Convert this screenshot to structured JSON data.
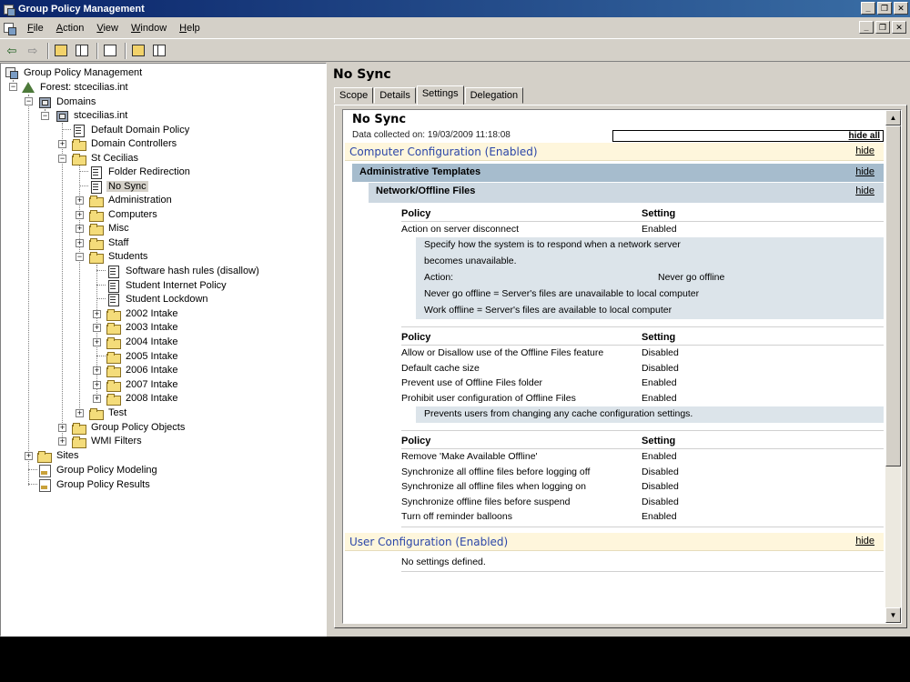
{
  "window": {
    "title": "Group Policy Management"
  },
  "menu": {
    "items": [
      {
        "label": "File",
        "key": "F",
        "rest": "ile"
      },
      {
        "label": "Action",
        "key": "A",
        "rest": "ction"
      },
      {
        "label": "View",
        "key": "V",
        "rest": "iew"
      },
      {
        "label": "Window",
        "key": "W",
        "rest": "indow"
      },
      {
        "label": "Help",
        "key": "H",
        "rest": "elp"
      }
    ]
  },
  "toolbar": {
    "icons": [
      "back-arrow-icon",
      "forward-arrow-icon",
      "up-folder-icon",
      "show-hide-tree-icon",
      "refresh-icon",
      "help-icon",
      "properties-icon"
    ],
    "back_glyph": "⇦",
    "forward_glyph": "⇨"
  },
  "tree": {
    "root": "Group Policy Management",
    "forest": "Forest: stcecilias.int",
    "domains": "Domains",
    "domain": "stcecilias.int",
    "default_domain_policy": "Default Domain Policy",
    "domain_controllers": "Domain Controllers",
    "st_cecilias": "St Cecilias",
    "folder_redirection": "Folder Redirection",
    "no_sync": "No Sync",
    "administration": "Administration",
    "computers": "Computers",
    "misc": "Misc",
    "staff": "Staff",
    "students": "Students",
    "software_hash_rules": "Software hash rules (disallow)",
    "student_internet_policy": "Student Internet Policy",
    "student_lockdown": "Student Lockdown",
    "intakes": [
      "2002 Intake",
      "2003 Intake",
      "2004 Intake",
      "2005 Intake",
      "2006 Intake",
      "2007 Intake",
      "2008 Intake"
    ],
    "test": "Test",
    "group_policy_objects": "Group Policy Objects",
    "wmi_filters": "WMI Filters",
    "sites": "Sites",
    "modeling": "Group Policy Modeling",
    "results": "Group Policy Results"
  },
  "right": {
    "title": "No Sync",
    "tabs": [
      "Scope",
      "Details",
      "Settings",
      "Delegation"
    ],
    "active_tab": "Settings"
  },
  "report": {
    "title": "No Sync",
    "collected": "Data collected on: 19/03/2009 11:18:08",
    "hide_all": "hide all",
    "hide": "hide",
    "computer_config": "Computer Configuration (Enabled)",
    "admin_templates": "Administrative Templates",
    "network_offline": "Network/Offline Files",
    "policy_header": "Policy",
    "setting_header": "Setting",
    "group1": {
      "rows": [
        {
          "policy": "Action on server disconnect",
          "setting": "Enabled"
        }
      ],
      "explain": {
        "line1": "Specify how the system is to respond when a network server",
        "line2": "becomes unavailable.",
        "action_label": "Action:",
        "action_value": "Never go offline",
        "line4": "Never go offline = Server's files are unavailable to local computer",
        "line5": "Work offline = Server's files are available to local computer"
      }
    },
    "group2": {
      "rows": [
        {
          "policy": "Allow or Disallow use of the Offline Files feature",
          "setting": "Disabled"
        },
        {
          "policy": "Default cache size",
          "setting": "Disabled"
        },
        {
          "policy": "Prevent use of Offline Files folder",
          "setting": "Enabled"
        },
        {
          "policy": "Prohibit user configuration of Offline Files",
          "setting": "Enabled"
        }
      ],
      "explain": "Prevents users from changing any cache configuration settings."
    },
    "group3": {
      "rows": [
        {
          "policy": "Remove 'Make Available Offline'",
          "setting": "Enabled"
        },
        {
          "policy": "Synchronize all offline files before logging off",
          "setting": "Disabled"
        },
        {
          "policy": "Synchronize all offline files when logging on",
          "setting": "Disabled"
        },
        {
          "policy": "Synchronize offline files before suspend",
          "setting": "Disabled"
        },
        {
          "policy": "Turn off reminder balloons",
          "setting": "Enabled"
        }
      ]
    },
    "user_config": "User Configuration (Enabled)",
    "no_settings": "No settings defined."
  }
}
